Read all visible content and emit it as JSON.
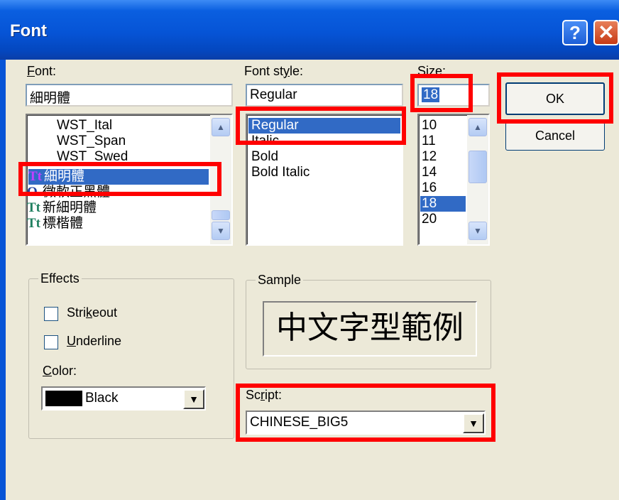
{
  "window": {
    "title": "Font",
    "help_glyph": "?",
    "close_glyph": "✕"
  },
  "font": {
    "label": "Font:",
    "label_accel": "F",
    "label_rest": "ont:",
    "value": "細明體",
    "items": [
      {
        "icon": "",
        "name": "WST_Ital"
      },
      {
        "icon": "",
        "name": "WST_Span"
      },
      {
        "icon": "",
        "name": "WST_Swed"
      },
      {
        "icon": "Tt",
        "name": "細明體"
      },
      {
        "icon": "O",
        "name": "微軟正黑體"
      },
      {
        "icon": "Tt",
        "name": "新細明體"
      },
      {
        "icon": "Tt",
        "name": "標楷體"
      }
    ],
    "selected_index": 3
  },
  "style": {
    "label_pre": "Font st",
    "label_accel": "y",
    "label_post": "le:",
    "value": "Regular",
    "items": [
      "Regular",
      "Italic",
      "Bold",
      "Bold Italic"
    ],
    "selected_index": 0
  },
  "size": {
    "label_accel": "S",
    "label_rest": "ize:",
    "value": "18",
    "items": [
      "10",
      "11",
      "12",
      "14",
      "16",
      "18",
      "20"
    ],
    "selected_index": 5
  },
  "buttons": {
    "ok": "OK",
    "cancel": "Cancel"
  },
  "effects": {
    "label": "Effects",
    "strikeout_pre": "Stri",
    "strikeout_accel": "k",
    "strikeout_post": "eout",
    "strikeout_checked": false,
    "underline_accel": "U",
    "underline_rest": "nderline",
    "underline_checked": false,
    "color_accel": "C",
    "color_rest": "olor:",
    "color_value": "Black",
    "color_swatch": "#000000"
  },
  "sample": {
    "label": "Sample",
    "text": "中文字型範例"
  },
  "script": {
    "label_pre": "Sc",
    "label_accel": "r",
    "label_post": "ipt:",
    "value": "CHINESE_BIG5"
  },
  "colors": {
    "highlight": "#ff0000",
    "selection": "#316ac5",
    "face": "#ece9d8"
  }
}
